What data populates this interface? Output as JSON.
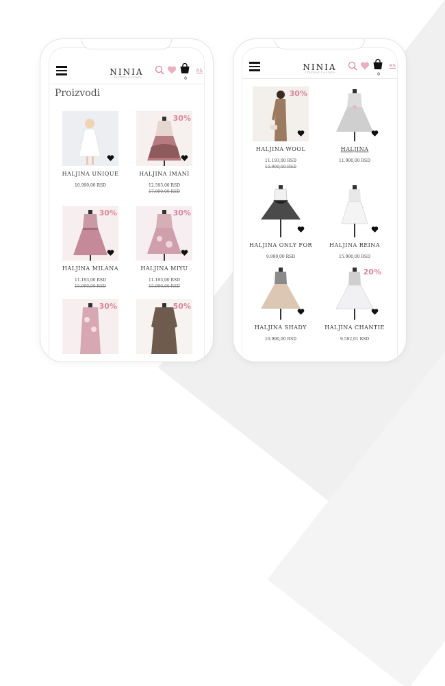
{
  "colors": {
    "accent": "#d7879b",
    "text": "#333333"
  },
  "phone_left": {
    "logo": "NINIA",
    "logo_sub": "Children Couture",
    "cart_count": "0",
    "rs_link": "RS",
    "page_title": "Proizvodi",
    "products": [
      {
        "name": "HALJINA UNIQUE",
        "price": "10.990,00 RSD",
        "old_price": "",
        "discount": ""
      },
      {
        "name": "HALJINA IMANI",
        "price": "12.593,00 RSD",
        "old_price": "17.990,00 RSD",
        "discount": "30%"
      },
      {
        "name": "HALJINA MILANA",
        "price": "11.193,00 RSD",
        "old_price": "15.990,00 RSD",
        "discount": "30%"
      },
      {
        "name": "HALJINA MIYU",
        "price": "11.193,00 RSD",
        "old_price": "15.990,00 RSD",
        "discount": "30%"
      },
      {
        "name": "",
        "price": "",
        "old_price": "",
        "discount": "30%"
      },
      {
        "name": "",
        "price": "",
        "old_price": "",
        "discount": "50%"
      }
    ]
  },
  "phone_right": {
    "logo": "NINIA",
    "logo_sub": "Children Couture",
    "cart_count": "0",
    "rs_link": "RS",
    "products": [
      {
        "name": "HALJINA WOOL",
        "price": "11.193,00 RSD",
        "old_price": "15.990,00 RSD",
        "discount": "30%"
      },
      {
        "name": "HALJINA",
        "price": "11.990,00 RSD",
        "old_price": "",
        "discount": ""
      },
      {
        "name": "HALJINA ONLY FOR",
        "price": "9.990,00 RSD",
        "old_price": "",
        "discount": ""
      },
      {
        "name": "HALJINA REINA",
        "price": "15.990,00 RSD",
        "old_price": "",
        "discount": ""
      },
      {
        "name": "HALJINA SHADY",
        "price": "10.990,00 RSD",
        "old_price": "",
        "discount": ""
      },
      {
        "name": "HALJINA CHANTIE",
        "price": "9.592,01 RSD",
        "old_price": "",
        "discount": "20%"
      }
    ]
  }
}
